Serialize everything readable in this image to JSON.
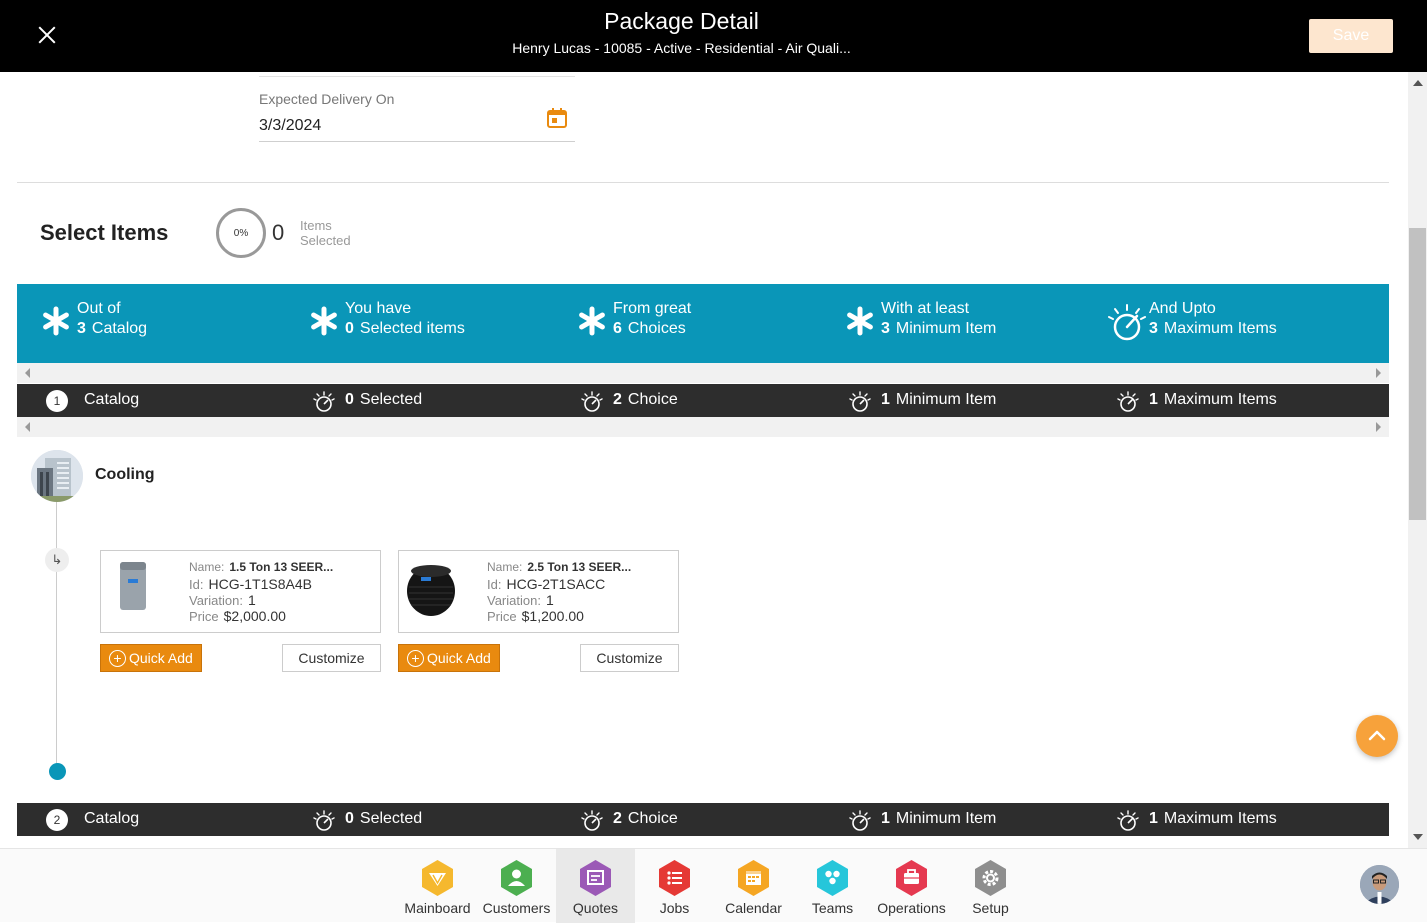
{
  "header": {
    "title": "Package Detail",
    "subtitle": "Henry Lucas - 10085 - Active - Residential - Air Quali...",
    "save_label": "Save"
  },
  "delivery": {
    "label": "Expected Delivery On",
    "value": "3/3/2024"
  },
  "select_items": {
    "title": "Select Items",
    "progress": "0%",
    "count": "0",
    "label_line1": "Items",
    "label_line2": "Selected"
  },
  "summary": [
    {
      "line1": "Out of",
      "value": "3",
      "text": "Catalog"
    },
    {
      "line1": "You have",
      "value": "0",
      "text": "Selected items"
    },
    {
      "line1": "From great",
      "value": "6",
      "text": "Choices"
    },
    {
      "line1": "With at least",
      "value": "3",
      "text": "Minimum Item"
    },
    {
      "line1": "And Upto",
      "value": "3",
      "text": "Maximum Items"
    }
  ],
  "catalogs": [
    {
      "number": "1",
      "name": "Catalog",
      "selected_value": "0",
      "selected_text": "Selected",
      "choice_value": "2",
      "choice_text": "Choice",
      "min_value": "1",
      "min_text": "Minimum Item",
      "max_value": "1",
      "max_text": "Maximum Items"
    },
    {
      "number": "2",
      "name": "Catalog",
      "selected_value": "0",
      "selected_text": "Selected",
      "choice_value": "2",
      "choice_text": "Choice",
      "min_value": "1",
      "min_text": "Minimum Item",
      "max_value": "1",
      "max_text": "Maximum Items"
    }
  ],
  "category": {
    "name": "Cooling"
  },
  "products": [
    {
      "name_key": "Name:",
      "name": "1.5 Ton 13 SEER...",
      "id_key": "Id:",
      "id": "HCG-1T1S8A4B",
      "variation_key": "Variation:",
      "variation": "1",
      "price_key": "Price",
      "price": "$2,000.00"
    },
    {
      "name_key": "Name:",
      "name": "2.5 Ton 13 SEER...",
      "id_key": "Id:",
      "id": "HCG-2T1SACC",
      "variation_key": "Variation:",
      "variation": "1",
      "price_key": "Price",
      "price": "$1,200.00"
    }
  ],
  "actions": {
    "quick_add": "Quick Add",
    "customize": "Customize"
  },
  "nav": [
    {
      "label": "Mainboard",
      "icon": "mainboard-icon",
      "color": "#f5b82e"
    },
    {
      "label": "Customers",
      "icon": "customers-icon",
      "color": "#4caf50"
    },
    {
      "label": "Quotes",
      "icon": "quotes-icon",
      "color": "#9b59b6"
    },
    {
      "label": "Jobs",
      "icon": "jobs-icon",
      "color": "#e53935"
    },
    {
      "label": "Calendar",
      "icon": "calendar-icon",
      "color": "#f5a623"
    },
    {
      "label": "Teams",
      "icon": "teams-icon",
      "color": "#26c6da"
    },
    {
      "label": "Operations",
      "icon": "operations-icon",
      "color": "#e53950"
    },
    {
      "label": "Setup",
      "icon": "setup-icon",
      "color": "#8e8e8e"
    }
  ],
  "colors": {
    "accent_teal": "#0a96b8",
    "accent_orange": "#e98a0f",
    "catalog_bar": "#2d2d2d"
  }
}
